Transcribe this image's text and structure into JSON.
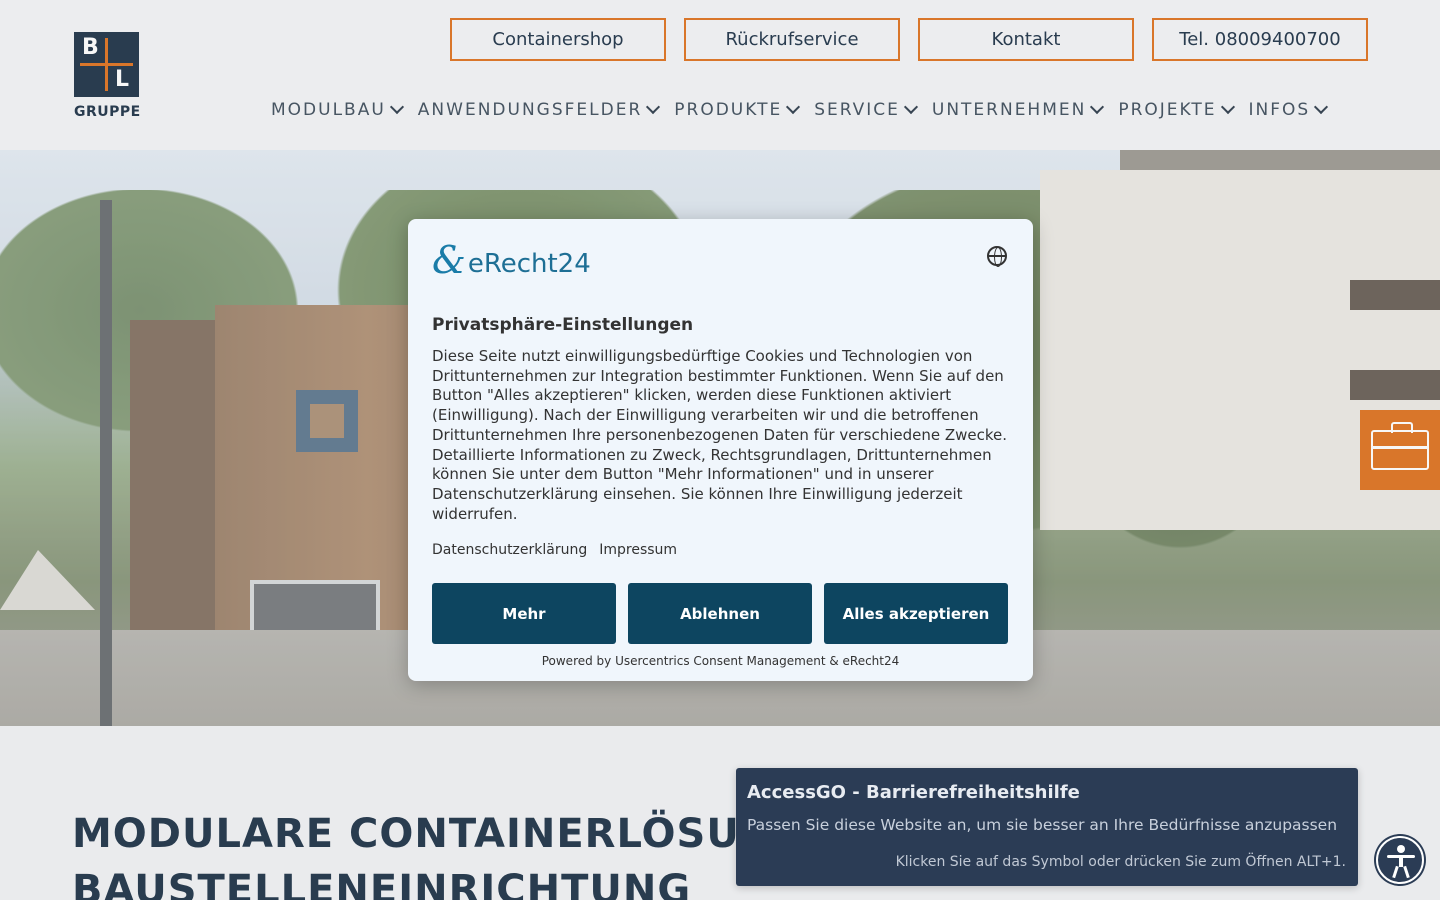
{
  "logo": {
    "letters": [
      "B",
      "L"
    ],
    "text": "GRUPPE"
  },
  "top_buttons": [
    "Containershop",
    "Rückrufservice",
    "Kontakt",
    "Tel. 08009400700"
  ],
  "nav": [
    "MODULBAU",
    "ANWENDUNGSFELDER",
    "PRODUKTE",
    "SERVICE",
    "UNTERNEHMEN",
    "PROJEKTE",
    "INFOS"
  ],
  "headline": {
    "line1": "MODULARE CONTAINERLÖSUN",
    "line2": "BAUSTELLENEINRICHTUNG"
  },
  "cookie": {
    "brand": "eRecht24",
    "title": "Privatsphäre-Einstellungen",
    "text": "Diese Seite nutzt einwilligungsbedürftige Cookies und Technologien von Drittunternehmen zur Integration bestimmter Funktionen. Wenn Sie auf den Button \"Alles akzeptieren\" klicken, werden diese Funktionen aktiviert (Einwilligung). Nach der Einwilligung verarbeiten wir und die betroffenen Drittunternehmen Ihre personenbezogenen Daten für verschiedene Zwecke. Detaillierte Informationen zu Zweck, Rechtsgrundlagen, Drittunternehmen können Sie unter dem Button \"Mehr Informationen\" und in unserer Datenschutzerklärung einsehen. Sie können Ihre Einwilligung jederzeit widerrufen.",
    "links": [
      "Datenschutzerklärung",
      "Impressum"
    ],
    "buttons": {
      "more": "Mehr",
      "decline": "Ablehnen",
      "accept": "Alles akzeptieren"
    },
    "powered": "Powered by Usercentrics Consent Management & eRecht24"
  },
  "access": {
    "title": "AccessGO - Barrierefreiheitshilfe",
    "subtitle": "Passen Sie diese Website an, um sie besser an Ihre Bedürfnisse anzupassen",
    "hint": "Klicken Sie auf das Symbol oder drücken Sie zum Öffnen ALT+1."
  },
  "colors": {
    "accent": "#e07a2c",
    "navy": "#2b3e52",
    "button": "#0d4560",
    "access_bg": "#2b3c55"
  },
  "icons": [
    "chevron-down-icon",
    "globe-icon",
    "briefcase-icon",
    "accessibility-icon"
  ]
}
